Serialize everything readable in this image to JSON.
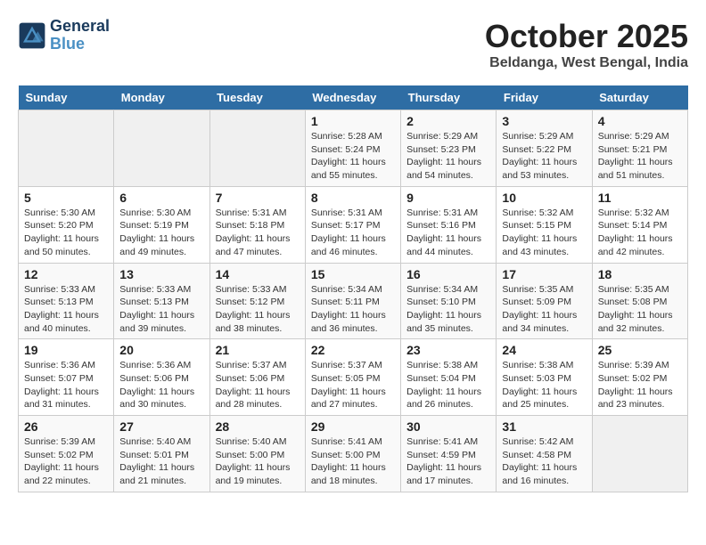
{
  "header": {
    "logo_line1": "General",
    "logo_line2": "Blue",
    "month_title": "October 2025",
    "subtitle": "Beldanga, West Bengal, India"
  },
  "days_of_week": [
    "Sunday",
    "Monday",
    "Tuesday",
    "Wednesday",
    "Thursday",
    "Friday",
    "Saturday"
  ],
  "weeks": [
    [
      {
        "day": "",
        "info": ""
      },
      {
        "day": "",
        "info": ""
      },
      {
        "day": "",
        "info": ""
      },
      {
        "day": "1",
        "info": "Sunrise: 5:28 AM\nSunset: 5:24 PM\nDaylight: 11 hours\nand 55 minutes."
      },
      {
        "day": "2",
        "info": "Sunrise: 5:29 AM\nSunset: 5:23 PM\nDaylight: 11 hours\nand 54 minutes."
      },
      {
        "day": "3",
        "info": "Sunrise: 5:29 AM\nSunset: 5:22 PM\nDaylight: 11 hours\nand 53 minutes."
      },
      {
        "day": "4",
        "info": "Sunrise: 5:29 AM\nSunset: 5:21 PM\nDaylight: 11 hours\nand 51 minutes."
      }
    ],
    [
      {
        "day": "5",
        "info": "Sunrise: 5:30 AM\nSunset: 5:20 PM\nDaylight: 11 hours\nand 50 minutes."
      },
      {
        "day": "6",
        "info": "Sunrise: 5:30 AM\nSunset: 5:19 PM\nDaylight: 11 hours\nand 49 minutes."
      },
      {
        "day": "7",
        "info": "Sunrise: 5:31 AM\nSunset: 5:18 PM\nDaylight: 11 hours\nand 47 minutes."
      },
      {
        "day": "8",
        "info": "Sunrise: 5:31 AM\nSunset: 5:17 PM\nDaylight: 11 hours\nand 46 minutes."
      },
      {
        "day": "9",
        "info": "Sunrise: 5:31 AM\nSunset: 5:16 PM\nDaylight: 11 hours\nand 44 minutes."
      },
      {
        "day": "10",
        "info": "Sunrise: 5:32 AM\nSunset: 5:15 PM\nDaylight: 11 hours\nand 43 minutes."
      },
      {
        "day": "11",
        "info": "Sunrise: 5:32 AM\nSunset: 5:14 PM\nDaylight: 11 hours\nand 42 minutes."
      }
    ],
    [
      {
        "day": "12",
        "info": "Sunrise: 5:33 AM\nSunset: 5:13 PM\nDaylight: 11 hours\nand 40 minutes."
      },
      {
        "day": "13",
        "info": "Sunrise: 5:33 AM\nSunset: 5:13 PM\nDaylight: 11 hours\nand 39 minutes."
      },
      {
        "day": "14",
        "info": "Sunrise: 5:33 AM\nSunset: 5:12 PM\nDaylight: 11 hours\nand 38 minutes."
      },
      {
        "day": "15",
        "info": "Sunrise: 5:34 AM\nSunset: 5:11 PM\nDaylight: 11 hours\nand 36 minutes."
      },
      {
        "day": "16",
        "info": "Sunrise: 5:34 AM\nSunset: 5:10 PM\nDaylight: 11 hours\nand 35 minutes."
      },
      {
        "day": "17",
        "info": "Sunrise: 5:35 AM\nSunset: 5:09 PM\nDaylight: 11 hours\nand 34 minutes."
      },
      {
        "day": "18",
        "info": "Sunrise: 5:35 AM\nSunset: 5:08 PM\nDaylight: 11 hours\nand 32 minutes."
      }
    ],
    [
      {
        "day": "19",
        "info": "Sunrise: 5:36 AM\nSunset: 5:07 PM\nDaylight: 11 hours\nand 31 minutes."
      },
      {
        "day": "20",
        "info": "Sunrise: 5:36 AM\nSunset: 5:06 PM\nDaylight: 11 hours\nand 30 minutes."
      },
      {
        "day": "21",
        "info": "Sunrise: 5:37 AM\nSunset: 5:06 PM\nDaylight: 11 hours\nand 28 minutes."
      },
      {
        "day": "22",
        "info": "Sunrise: 5:37 AM\nSunset: 5:05 PM\nDaylight: 11 hours\nand 27 minutes."
      },
      {
        "day": "23",
        "info": "Sunrise: 5:38 AM\nSunset: 5:04 PM\nDaylight: 11 hours\nand 26 minutes."
      },
      {
        "day": "24",
        "info": "Sunrise: 5:38 AM\nSunset: 5:03 PM\nDaylight: 11 hours\nand 25 minutes."
      },
      {
        "day": "25",
        "info": "Sunrise: 5:39 AM\nSunset: 5:02 PM\nDaylight: 11 hours\nand 23 minutes."
      }
    ],
    [
      {
        "day": "26",
        "info": "Sunrise: 5:39 AM\nSunset: 5:02 PM\nDaylight: 11 hours\nand 22 minutes."
      },
      {
        "day": "27",
        "info": "Sunrise: 5:40 AM\nSunset: 5:01 PM\nDaylight: 11 hours\nand 21 minutes."
      },
      {
        "day": "28",
        "info": "Sunrise: 5:40 AM\nSunset: 5:00 PM\nDaylight: 11 hours\nand 19 minutes."
      },
      {
        "day": "29",
        "info": "Sunrise: 5:41 AM\nSunset: 5:00 PM\nDaylight: 11 hours\nand 18 minutes."
      },
      {
        "day": "30",
        "info": "Sunrise: 5:41 AM\nSunset: 4:59 PM\nDaylight: 11 hours\nand 17 minutes."
      },
      {
        "day": "31",
        "info": "Sunrise: 5:42 AM\nSunset: 4:58 PM\nDaylight: 11 hours\nand 16 minutes."
      },
      {
        "day": "",
        "info": ""
      }
    ]
  ]
}
